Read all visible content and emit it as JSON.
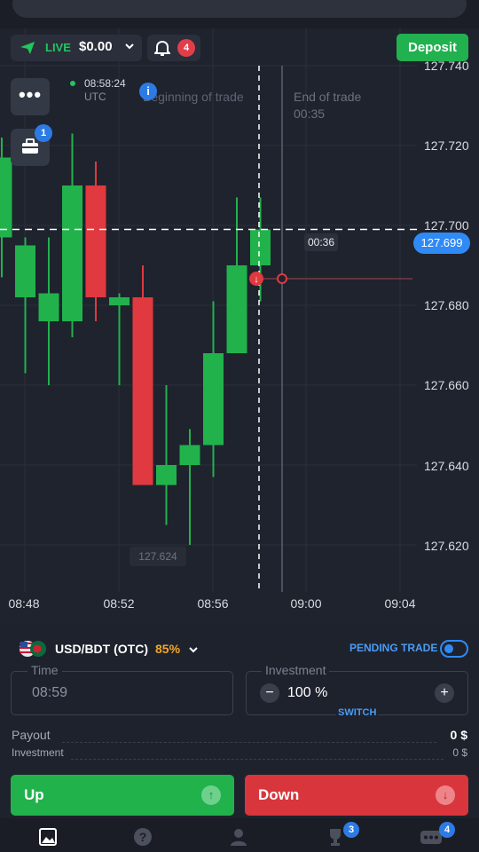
{
  "browser": {
    "url": "market-qxtrade"
  },
  "header": {
    "account_mode": "LIVE",
    "balance": "$0.00",
    "notifications_count": "4",
    "deposit_label": "Deposit",
    "trades_badge": "1"
  },
  "chart": {
    "current_time": "08:58:24",
    "timezone": "UTC",
    "info_glyph": "i",
    "beginning_label": "Beginning of trade",
    "end_label": "End of trade",
    "end_time": "00:35",
    "timer": "00:36",
    "current_price": "127.699",
    "low_label": "127.624",
    "y_labels": [
      "127.740",
      "127.720",
      "127.700",
      "127.680",
      "127.660",
      "127.640",
      "127.620"
    ],
    "x_labels": [
      "08:48",
      "08:52",
      "08:56",
      "09:00",
      "09:04"
    ]
  },
  "chart_data": {
    "type": "candlestick",
    "y_ticks": [
      127.74,
      127.72,
      127.7,
      127.68,
      127.66,
      127.64,
      127.62
    ],
    "x_ticks": [
      "08:48",
      "08:52",
      "08:56",
      "09:00",
      "09:04"
    ],
    "current_price": 127.699,
    "candles": [
      {
        "open": 127.697,
        "high": 127.722,
        "low": 127.687,
        "close": 127.717
      },
      {
        "open": 127.682,
        "high": 127.697,
        "low": 127.663,
        "close": 127.695
      },
      {
        "open": 127.676,
        "high": 127.697,
        "low": 127.66,
        "close": 127.683
      },
      {
        "open": 127.676,
        "high": 127.723,
        "low": 127.672,
        "close": 127.71
      },
      {
        "open": 127.71,
        "high": 127.716,
        "low": 127.676,
        "close": 127.682
      },
      {
        "open": 127.68,
        "high": 127.683,
        "low": 127.66,
        "close": 127.682
      },
      {
        "open": 127.682,
        "high": 127.69,
        "low": 127.638,
        "close": 127.635
      },
      {
        "open": 127.635,
        "high": 127.66,
        "low": 127.625,
        "close": 127.64
      },
      {
        "open": 127.64,
        "high": 127.649,
        "low": 127.62,
        "close": 127.645
      },
      {
        "open": 127.645,
        "high": 127.681,
        "low": 127.637,
        "close": 127.668
      },
      {
        "open": 127.668,
        "high": 127.707,
        "low": 127.668,
        "close": 127.69
      },
      {
        "open": 127.69,
        "high": 127.707,
        "low": 127.681,
        "close": 127.699
      }
    ],
    "colors": {
      "up": "#22b24c",
      "down": "#e0393f"
    }
  },
  "trade": {
    "pair": "USD/BDT (OTC)",
    "payout_percent": "85%",
    "pending_label": "PENDING TRADE",
    "time_label": "Time",
    "time_value": "08:59",
    "investment_label": "Investment",
    "investment_value": "100 %",
    "minus": "−",
    "plus": "+",
    "switch_label": "SWITCH",
    "payout_label": "Payout",
    "payout_value": "0 $",
    "investment_row_label": "Investment",
    "investment_row_value": "0 $",
    "up_label": "Up",
    "down_label": "Down",
    "up_glyph": "↑",
    "down_glyph": "↓"
  },
  "nav": {
    "trophy_badge": "3",
    "more_badge": "4"
  }
}
